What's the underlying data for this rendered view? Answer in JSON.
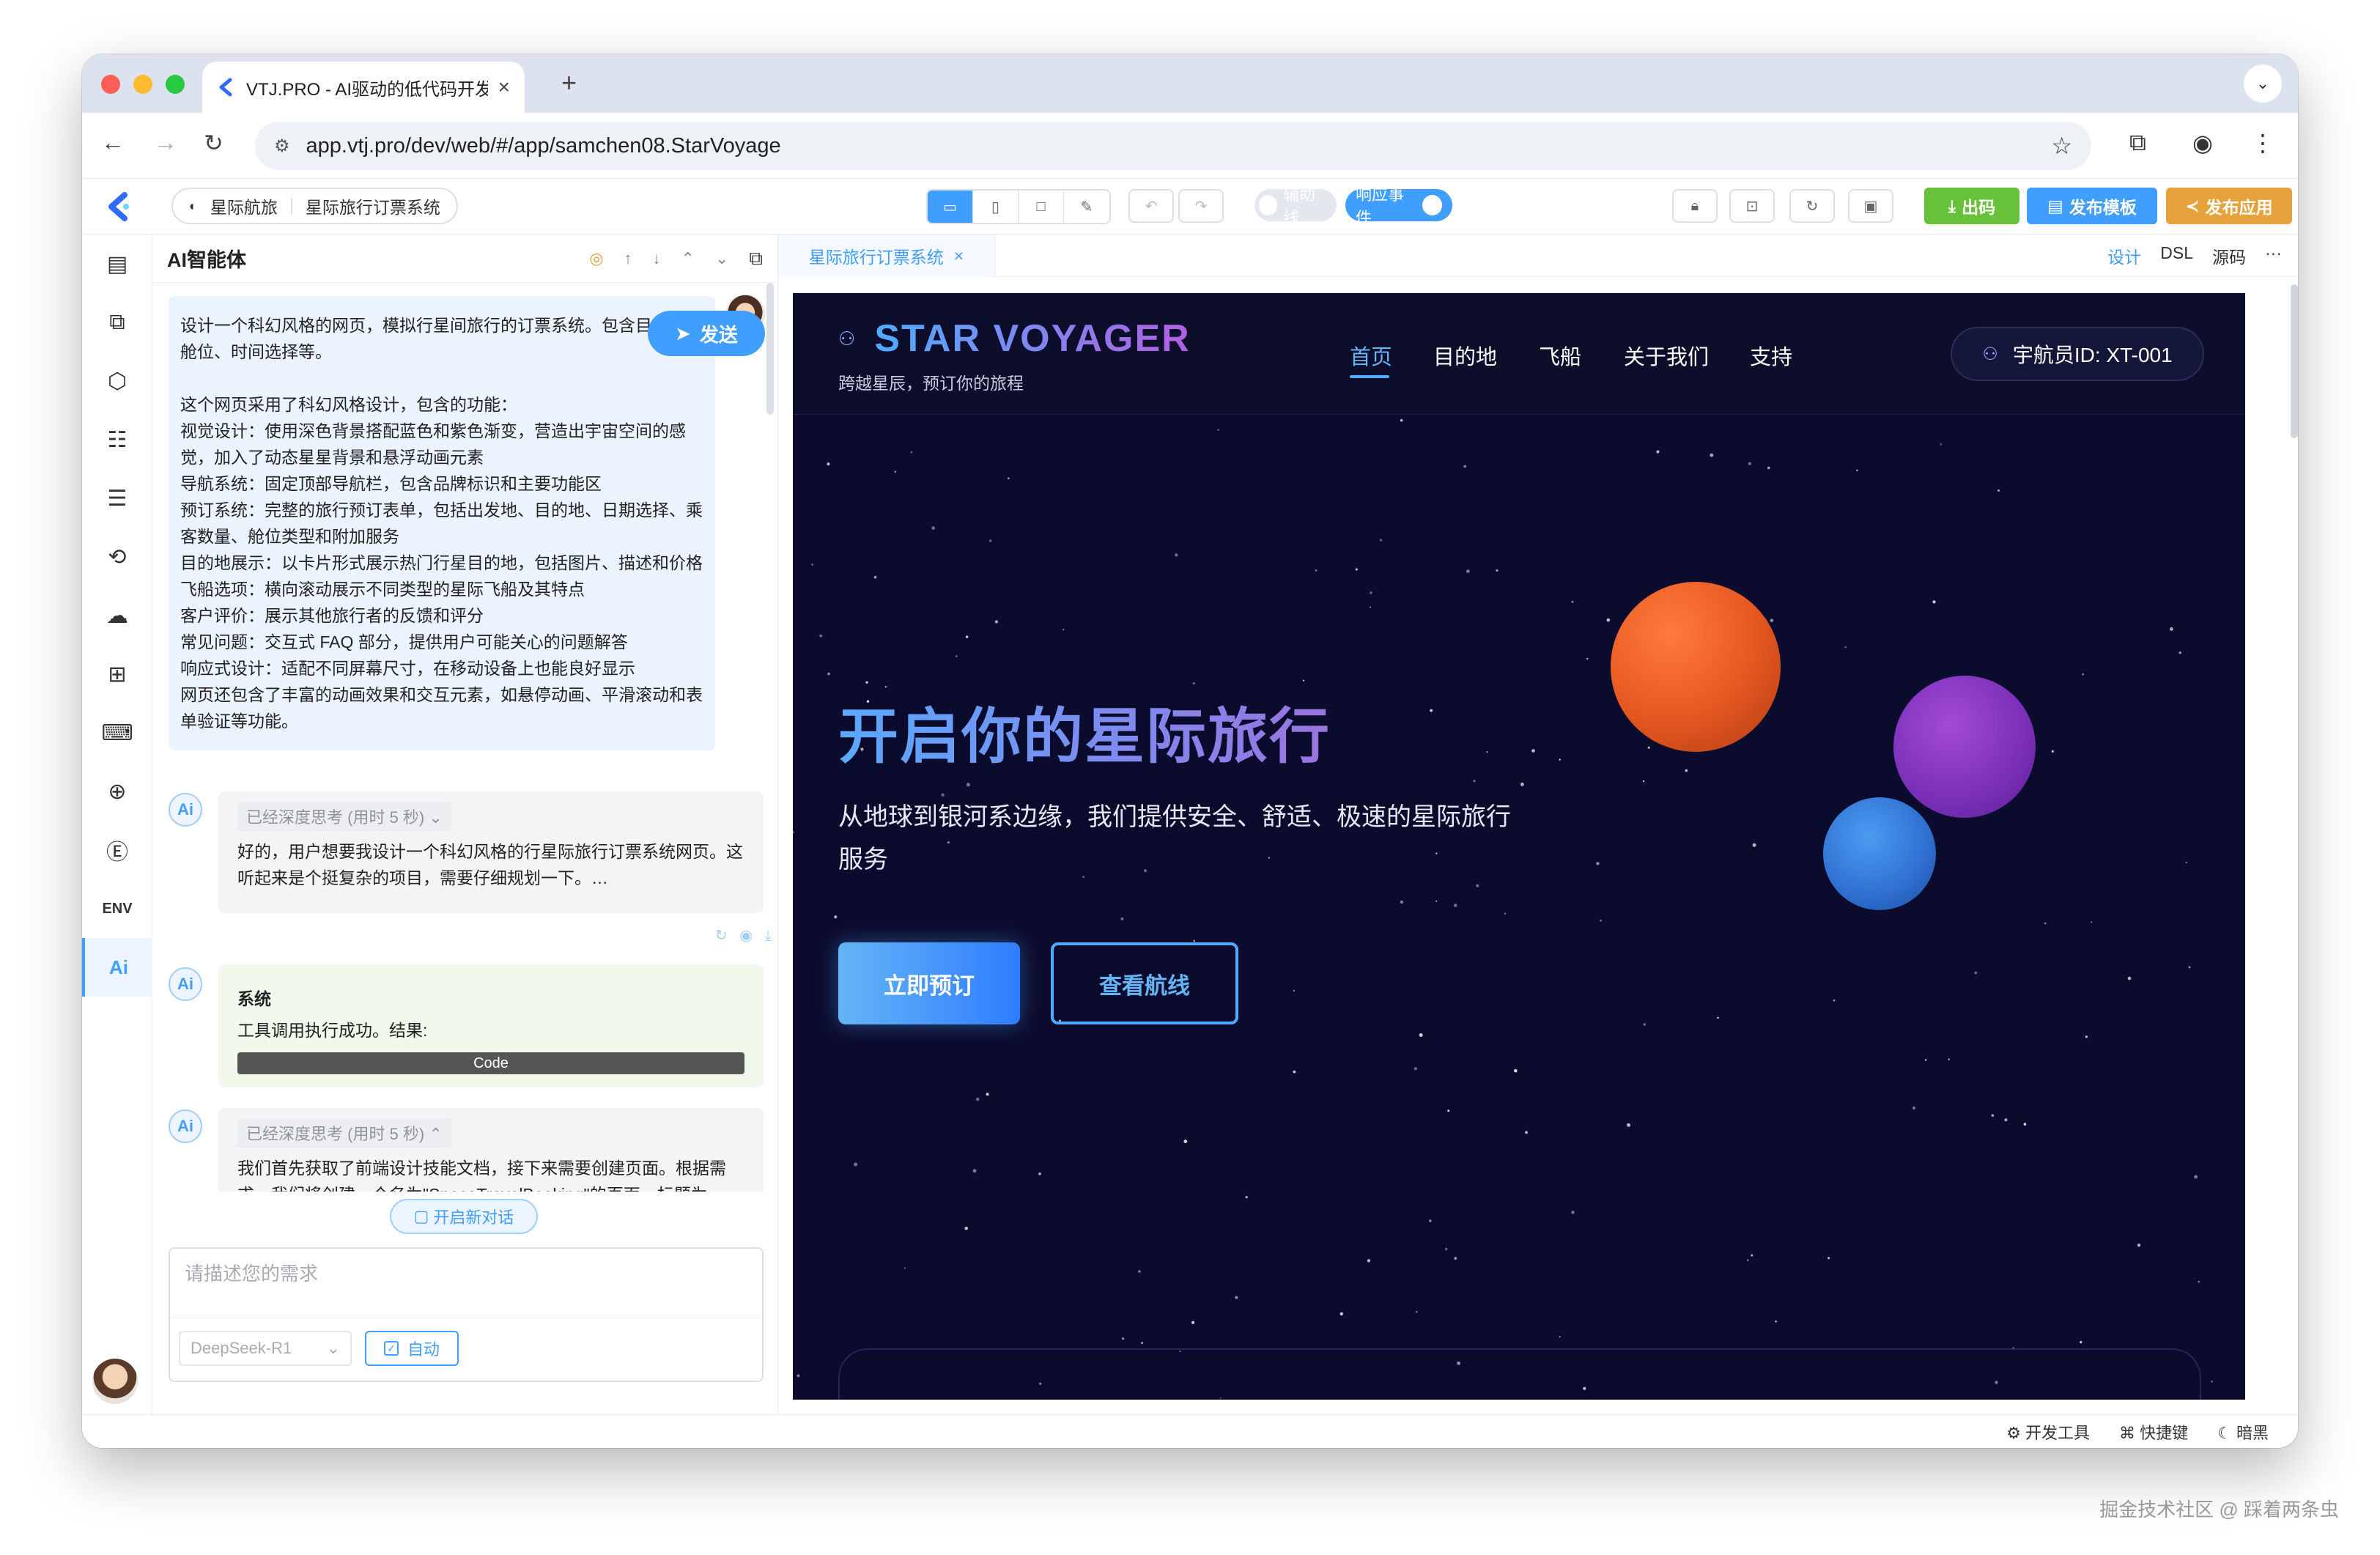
{
  "browser": {
    "tab_title": "VTJ.PRO - AI驱动的低代码开发",
    "url": "app.vtj.pro/dev/web/#/app/samchen08.StarVoyage"
  },
  "app_header": {
    "breadcrumb_app": "星际航旅",
    "breadcrumb_page": "星际旅行订票系统",
    "toggle_guides": "辅助线",
    "toggle_events": "响应事件",
    "btn_code": "出码",
    "btn_publish_template": "发布模板",
    "btn_publish_app": "发布应用"
  },
  "ai_panel": {
    "title": "AI智能体",
    "user_message": "设计一个科幻风格的网页，模拟行星间旅行的订票系统。包含目的地、舱位、时间选择等。\n\n这个网页采用了科幻风格设计，包含的功能：\n视觉设计：使用深色背景搭配蓝色和紫色渐变，营造出宇宙空间的感觉，加入了动态星星背景和悬浮动画元素\n导航系统：固定顶部导航栏，包含品牌标识和主要功能区\n预订系统：完整的旅行预订表单，包括出发地、目的地、日期选择、乘客数量、舱位类型和附加服务\n目的地展示：以卡片形式展示热门行星目的地，包括图片、描述和价格\n飞船选项：横向滚动展示不同类型的星际飞船及其特点\n客户评价：展示其他旅行者的反馈和评分\n常见问题：交互式 FAQ 部分，提供用户可能关心的问题解答\n响应式设计：适配不同屏幕尺寸，在移动设备上也能良好显示\n网页还包含了丰富的动画效果和交互元素，如悬停动画、平滑滚动和表单验证等功能。",
    "think1_tag": "已经深度思考 (用时 5 秒) ⌄",
    "think1_text": "好的，用户想要我设计一个科幻风格的行星际旅行订票系统网页。这听起来是个挺复杂的项目，需要仔细规划一下。…",
    "system_title": "系统",
    "system_text": "工具调用执行成功。结果:",
    "code_label": "Code",
    "think2_tag": "已经深度思考 (用时 5 秒) ⌃",
    "think2_text": "我们首先获取了前端设计技能文档，接下来需要创建页面。根据需求，我们将创建一个名为\"SpaceTravelBooking\"的页面，标题为",
    "new_chat": "开启新对话",
    "input_placeholder": "请描述您的需求",
    "model": "DeepSeek-R1",
    "auto_label": "自动",
    "send_label": "发送",
    "ai_badge": "Ai"
  },
  "designer": {
    "tab_label": "星际旅行订票系统",
    "mode_design": "设计",
    "mode_dsl": "DSL",
    "mode_source": "源码",
    "more": "···"
  },
  "site": {
    "brand": "STAR VOYAGER",
    "tagline": "跨越星辰，预订你的旅程",
    "menu": [
      "首页",
      "目的地",
      "飞船",
      "关于我们",
      "支持"
    ],
    "pilot": "宇航员ID: XT-001",
    "hero_title": "开启你的星际旅行",
    "hero_sub": "从地球到银河系边缘，我们提供安全、舒适、极速的星际旅行服务",
    "btn_book": "立即预订",
    "btn_routes": "查看航线"
  },
  "statusbar": {
    "devtools": "⚙ 开发工具",
    "shortcuts": "⌘ 快捷键",
    "dark": "☾ 暗黑"
  },
  "watermark": "掘金技术社区 @ 踩着两条虫",
  "colors": {
    "accent": "#409eff",
    "canvas_bg": "#0b0b2d",
    "code_btn": "#67c23a",
    "template_btn": "#409eff",
    "publish_btn": "#e6a23c"
  }
}
